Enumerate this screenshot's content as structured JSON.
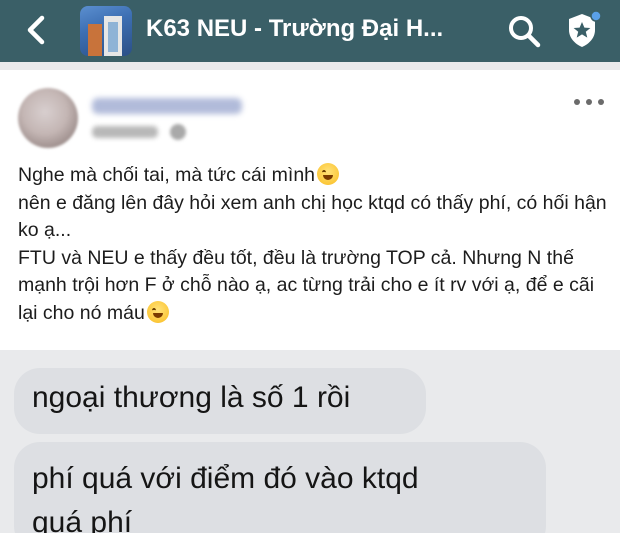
{
  "header": {
    "group_title": "K63 NEU - Trường Đại H...",
    "back_icon": "chevron-left-icon",
    "search_icon": "search-icon",
    "shield_icon": "shield-star-icon",
    "bar_color": "#3a5f67"
  },
  "post": {
    "lines": [
      "Nghe mà chối tai, mà tức cái mình",
      "nên e đăng lên đây hỏi xem anh chị học ktqd có thấy phí, có hối hận ko ạ...",
      "FTU và NEU e thấy đều tốt, đều là trường TOP cả. Nhưng N thế mạnh trội hơn F ở chỗ nào ạ, ac từng trải cho e ít rv với ạ, để e cãi lại cho nó máu"
    ],
    "more_icon": "more-horizontal-icon"
  },
  "chat": {
    "bubble_1": "ngoại thương là số 1 rồi",
    "bubble_2_line1": "phí quá với điểm đó vào ktqd",
    "bubble_2_line2": "quá phí"
  }
}
